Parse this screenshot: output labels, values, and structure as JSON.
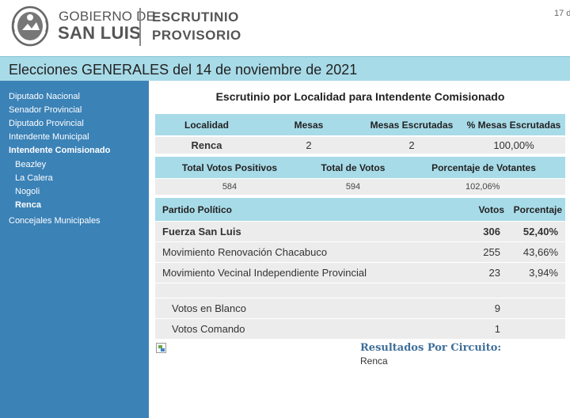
{
  "header": {
    "gov_line1": "GOBIERNO DE",
    "gov_line2": "SAN LUIS",
    "escrutinio_line1": "ESCRUTINIO",
    "escrutinio_line2": "PROVISORIO",
    "date_partial": "17 d"
  },
  "title_bar": {
    "text": "Elecciones GENERALES del 14 de noviembre de 2021"
  },
  "sidebar": {
    "items": [
      {
        "label": "Diputado Nacional",
        "bold": false,
        "sub": false
      },
      {
        "label": "Senador Provincial",
        "bold": false,
        "sub": false
      },
      {
        "label": "Diputado Provincial",
        "bold": false,
        "sub": false
      },
      {
        "label": "Intendente Municipal",
        "bold": false,
        "sub": false
      },
      {
        "label": "Intendente Comisionado",
        "bold": true,
        "sub": false
      },
      {
        "label": "Beazley",
        "bold": false,
        "sub": true
      },
      {
        "label": "La Calera",
        "bold": false,
        "sub": true
      },
      {
        "label": "Nogoli",
        "bold": false,
        "sub": true
      },
      {
        "label": "Renca",
        "bold": true,
        "sub": true
      },
      {
        "label": "Concejales Municipales",
        "bold": false,
        "sub": false
      }
    ]
  },
  "main": {
    "title": "Escrutinio por Localidad para Intendente Comisionado",
    "locality_table": {
      "headers": [
        "Localidad",
        "Mesas",
        "Mesas Escrutadas",
        "% Mesas Escrutadas"
      ],
      "row": [
        "Renca",
        "2",
        "2",
        "100,00%"
      ]
    },
    "totals_table": {
      "headers": [
        "Total Votos Positivos",
        "Total de Votos",
        "Porcentaje de Votantes"
      ],
      "row": [
        "584",
        "594",
        "102,06%"
      ]
    },
    "party_table": {
      "headers": [
        "Partido Político",
        "Votos",
        "Porcentaje"
      ],
      "rows": [
        {
          "party": "Fuerza San Luis",
          "votes": "306",
          "percent": "52,40%"
        },
        {
          "party": "Movimiento Renovación Chacabuco",
          "votes": "255",
          "percent": "43,66%"
        },
        {
          "party": "Movimiento Vecinal Independiente Provincial",
          "votes": "23",
          "percent": "3,94%"
        }
      ],
      "extra_rows": [
        {
          "label": "Votos en Blanco",
          "votes": "9"
        },
        {
          "label": "Votos Comando",
          "votes": "1"
        }
      ]
    },
    "circuit": {
      "title": "Resultados Por Circuito:",
      "value": "Renca"
    }
  },
  "colors": {
    "header_blue": "#a8dbe8",
    "sidebar_blue": "#3b82b7",
    "row_gray": "#ececec",
    "link_blue": "#3f6f99"
  }
}
